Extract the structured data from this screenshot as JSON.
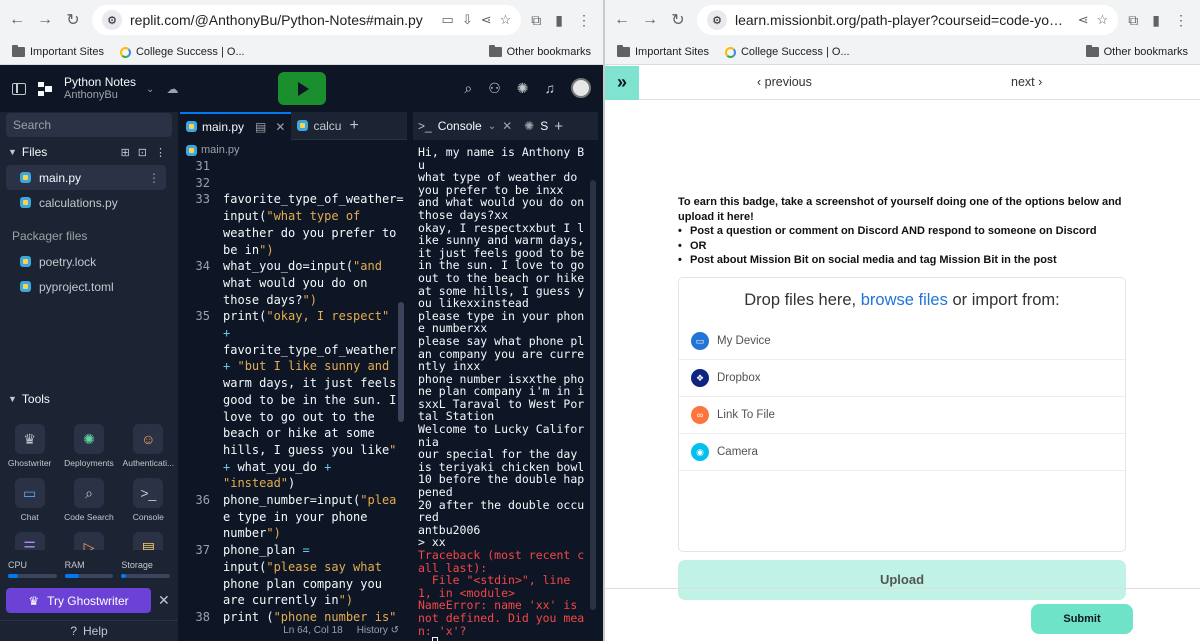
{
  "left_browser": {
    "url": "replit.com/@AnthonyBu/Python-Notes#main.py",
    "bookmarks": [
      "Important Sites",
      "College Success | O..."
    ],
    "other_bookmarks": "Other bookmarks"
  },
  "right_browser": {
    "url": "learn.missionbit.org/path-player?courseid=code-your-way-python...",
    "bookmarks": [
      "Important Sites",
      "College Success | O..."
    ],
    "other_bookmarks": "Other bookmarks"
  },
  "replit": {
    "project_title": "Python Notes",
    "project_owner": "AnthonyBu",
    "search_placeholder": "Search",
    "files_label": "Files",
    "files": [
      "main.py",
      "calculations.py"
    ],
    "packager_label": "Packager files",
    "packager_files": [
      "poetry.lock",
      "pyproject.toml"
    ],
    "tools_label": "Tools",
    "tools": [
      "Ghostwriter",
      "Deployments",
      "Authenticati...",
      "Chat",
      "Code Search",
      "Console"
    ],
    "usage": [
      {
        "label": "CPU",
        "fill": 0.2
      },
      {
        "label": "RAM",
        "fill": 0.3
      },
      {
        "label": "Storage",
        "fill": 0.1
      }
    ],
    "ghostwriter_button": "Try Ghostwriter",
    "help_label": "Help",
    "editor_tabs": [
      "main.py",
      "calcu"
    ],
    "breadcrumb": "main.py",
    "status": "Ln 64, Col 18",
    "history": "History",
    "console_tab": "Console",
    "console_tab2": "S",
    "code_lines": [
      {
        "n": "31",
        "t": ""
      },
      {
        "n": "32",
        "t": ""
      },
      {
        "n": "33",
        "t": "favorite_type_of_weather="
      },
      {
        "n": "",
        "t": "input(\"what type of"
      },
      {
        "n": "",
        "t": "weather do you prefer to"
      },
      {
        "n": "",
        "t": "be in\")"
      },
      {
        "n": "34",
        "t": "what_you_do=input(\"and"
      },
      {
        "n": "",
        "t": "what would you do on"
      },
      {
        "n": "",
        "t": "those days?\")"
      },
      {
        "n": "35",
        "t": "print(\"okay, I respect\""
      },
      {
        "n": "",
        "t": "+"
      },
      {
        "n": "",
        "t": "favorite_type_of_weather"
      },
      {
        "n": "",
        "t": "+ \"but I like sunny and"
      },
      {
        "n": "",
        "t": "warm days, it just feels"
      },
      {
        "n": "",
        "t": "good to be in the sun. I"
      },
      {
        "n": "",
        "t": "love to go out to the"
      },
      {
        "n": "",
        "t": "beach or hike at some"
      },
      {
        "n": "",
        "t": "hills, I guess you like\""
      },
      {
        "n": "",
        "t": "+ what_you_do +"
      },
      {
        "n": "",
        "t": "\"instead\")"
      },
      {
        "n": "36",
        "t": "phone_number=input(\"plea"
      },
      {
        "n": "",
        "t": "e type in your phone"
      },
      {
        "n": "",
        "t": "number\")"
      },
      {
        "n": "37",
        "t": "phone_plan ="
      },
      {
        "n": "",
        "t": "input(\"please say what"
      },
      {
        "n": "",
        "t": "phone plan company you"
      },
      {
        "n": "",
        "t": "are currently in\")"
      },
      {
        "n": "38",
        "t": "print (\"phone number is\""
      }
    ],
    "console_output": "Hi, my name is Anthony Bu\nwhat type of weather do you prefer to be inxx\nand what would you do on those days?xx\nokay, I respectxxbut I like sunny and warm days, it just feels good to be in the sun. I love to go out to the beach or hike at some hills, I guess you likexxinstead\nplease type in your phone numberxx\nplease say what phone plan company you are currently inxx\nphone number isxxthe phone plan company i'm in isxxL Taraval to West Portal Station\nWelcome to Lucky California\nour special for the day is teriyaki chicken bowl\n10 before the double happened\n20 after the double occured\nantbu2006",
    "console_prompt": "> xx",
    "console_error": "Traceback (most recent call last):\n  File \"<stdin>\", line 1, in <module>\nNameError: name 'xx' is not defined. Did you mean: 'x'?",
    "console_end": "> "
  },
  "missionbit": {
    "prev_label": "‹ previous",
    "next_label": "next ›",
    "instructions": "To earn this badge, take a screenshot of yourself doing one of the options below and upload it here!",
    "options": [
      "Post a question or comment on Discord AND respond to someone on Discord",
      "OR",
      "Post about Mission Bit on social media and tag Mission Bit in the post"
    ],
    "drop_text_1": "Drop files here,",
    "drop_link": "browse files",
    "drop_text_2": "or import from:",
    "sources": [
      {
        "label": "My Device",
        "color": "#2275d7"
      },
      {
        "label": "Dropbox",
        "color": "#0d2481"
      },
      {
        "label": "Link To File",
        "color": "#ff753e"
      },
      {
        "label": "Camera",
        "color": "#03bfef"
      }
    ],
    "upload_button": "Upload",
    "submit_button": "Submit"
  }
}
